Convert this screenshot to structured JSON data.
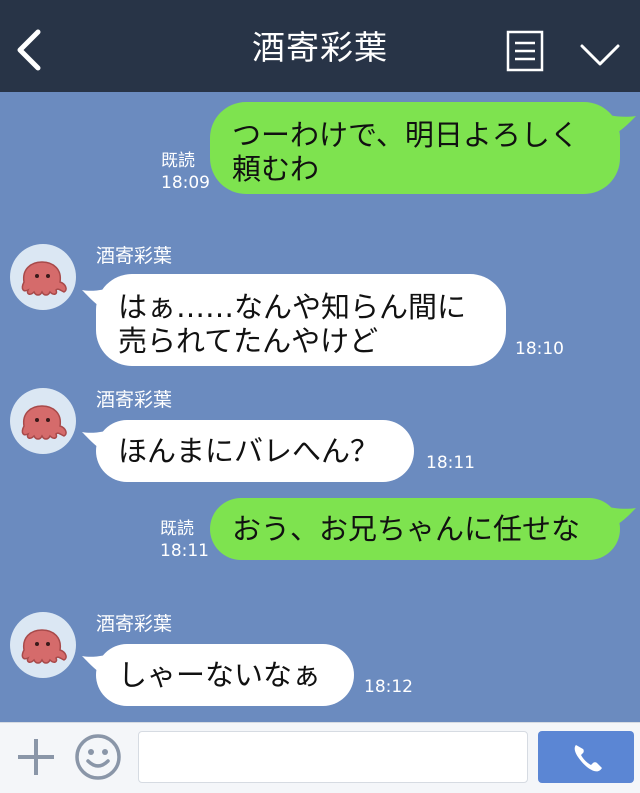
{
  "header": {
    "title": "酒寄彩葉",
    "back_icon": "chevron-left-icon",
    "menu_icon": "menu-list-icon",
    "collapse_icon": "chevron-down-icon"
  },
  "messages": [
    {
      "direction": "out",
      "lines": [
        "つーわけで、明日よろしく",
        "頼むわ"
      ],
      "read": "既読",
      "time": "18:09"
    },
    {
      "direction": "in",
      "sender": "酒寄彩葉",
      "lines": [
        "はぁ……なんや知らん間に",
        "売られてたんやけど"
      ],
      "time": "18:10"
    },
    {
      "direction": "in",
      "sender": "酒寄彩葉",
      "lines": [
        "ほんまにバレへん？"
      ],
      "time": "18:11"
    },
    {
      "direction": "out",
      "lines": [
        "おう、お兄ちゃんに任せな"
      ],
      "read": "既読",
      "time": "18:11"
    },
    {
      "direction": "in",
      "sender": "酒寄彩葉",
      "lines": [
        "しゃーないなぁ"
      ],
      "time": "18:12"
    }
  ],
  "input": {
    "placeholder": "",
    "plus_icon": "plus-icon",
    "emoji_icon": "smiley-icon",
    "call_icon": "phone-icon"
  },
  "colors": {
    "header_bg": "#283447",
    "chat_bg": "#6b8bbf",
    "outgoing_bubble": "#7ee34f",
    "incoming_bubble": "#ffffff",
    "call_button": "#5b86d4"
  }
}
